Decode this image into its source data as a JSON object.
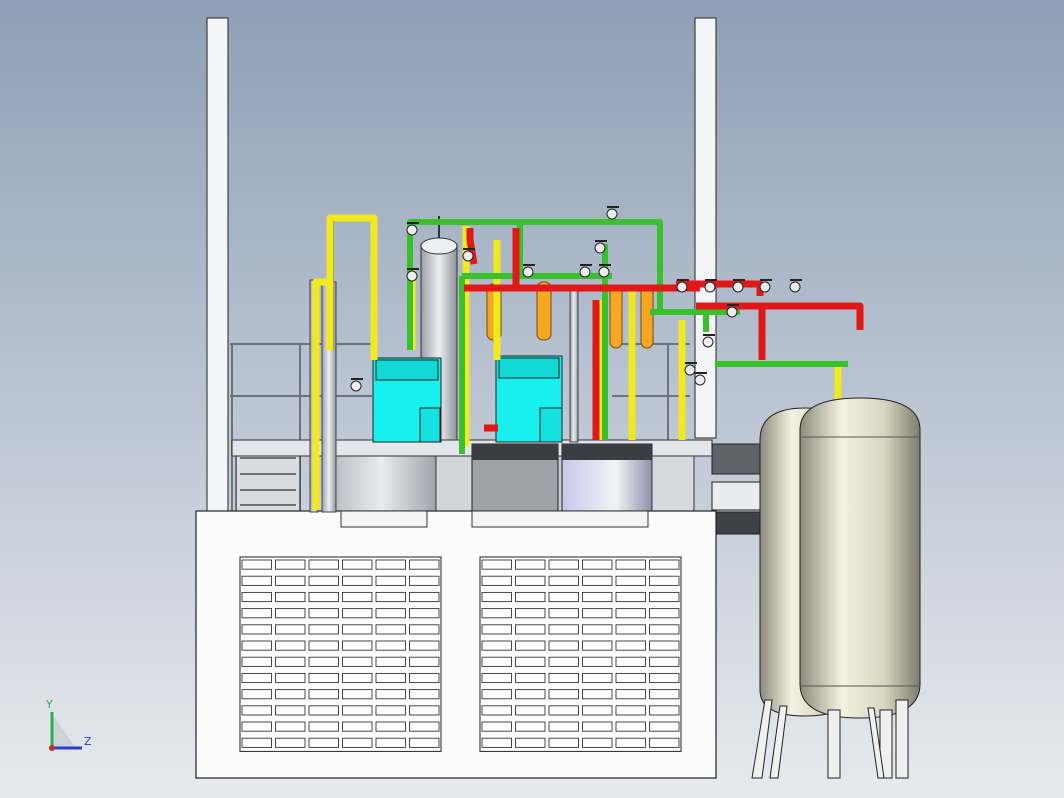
{
  "viewport": {
    "background_top": "#8E9FB5",
    "background_bottom": "#E7EAEF"
  },
  "triad": {
    "y_label": "Y",
    "z_label": "Z",
    "y_color": "#2BB04A",
    "z_color": "#2A3ED0",
    "x_color": "#D3232A"
  },
  "colors": {
    "pipe_green": "#38C12A",
    "pipe_red": "#E01818",
    "pipe_yellow": "#F2E81E",
    "cabinet_cyan": "#17F0EE",
    "filter_orange": "#F5A623",
    "tank": "#E6E2CF",
    "steel": "#C9CDD4",
    "dark_steel": "#5A5F66",
    "outline": "#1A1A1A"
  }
}
